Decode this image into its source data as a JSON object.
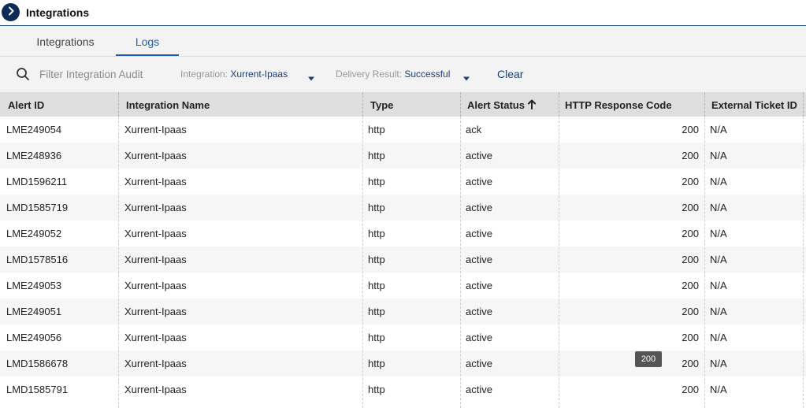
{
  "header": {
    "title": "Integrations"
  },
  "tabs": [
    {
      "label": "Integrations",
      "active": false
    },
    {
      "label": "Logs",
      "active": true
    }
  ],
  "filters": {
    "search_placeholder": "Filter Integration Audit",
    "integration_label": "Integration:",
    "integration_value": "Xurrent-Ipaas",
    "delivery_label": "Delivery Result:",
    "delivery_value": "Successful",
    "clear_label": "Clear"
  },
  "table": {
    "columns": [
      "Alert ID",
      "Integration Name",
      "Type",
      "Alert Status",
      "HTTP Response Code",
      "External Ticket ID"
    ],
    "sort": {
      "column": "Alert Status",
      "direction": "ascending"
    },
    "rows": [
      [
        "LME249054",
        "Xurrent-Ipaas",
        "http",
        "ack",
        "200",
        "N/A"
      ],
      [
        "LME248936",
        "Xurrent-Ipaas",
        "http",
        "active",
        "200",
        "N/A"
      ],
      [
        "LMD1596211",
        "Xurrent-Ipaas",
        "http",
        "active",
        "200",
        "N/A"
      ],
      [
        "LMD1585719",
        "Xurrent-Ipaas",
        "http",
        "active",
        "200",
        "N/A"
      ],
      [
        "LME249052",
        "Xurrent-Ipaas",
        "http",
        "active",
        "200",
        "N/A"
      ],
      [
        "LMD1578516",
        "Xurrent-Ipaas",
        "http",
        "active",
        "200",
        "N/A"
      ],
      [
        "LME249053",
        "Xurrent-Ipaas",
        "http",
        "active",
        "200",
        "N/A"
      ],
      [
        "LME249051",
        "Xurrent-Ipaas",
        "http",
        "active",
        "200",
        "N/A"
      ],
      [
        "LME249056",
        "Xurrent-Ipaas",
        "http",
        "active",
        "200",
        "N/A"
      ],
      [
        "LMD1586678",
        "Xurrent-Ipaas",
        "http",
        "active",
        "200",
        "N/A"
      ],
      [
        "LMD1585791",
        "Xurrent-Ipaas",
        "http",
        "active",
        "200",
        "N/A"
      ]
    ]
  },
  "tooltip": {
    "text": "200"
  },
  "colors": {
    "accent": "#1d5fb4",
    "nav_button": "#0e2b55",
    "header_bg": "#dedede"
  },
  "icons": {
    "nav": "chevron-right-icon",
    "search": "search-icon",
    "sort": "arrow-up-icon",
    "dropdown": "caret-down-icon"
  }
}
